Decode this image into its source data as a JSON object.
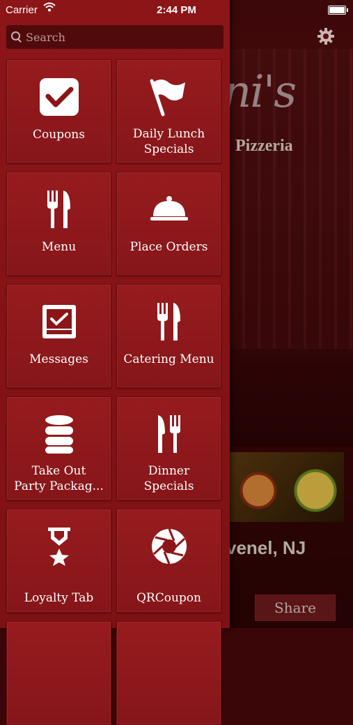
{
  "status_bar": {
    "carrier": "Carrier",
    "time": "2:44 PM",
    "wifi_icon": "wifi-icon",
    "battery_icon": "battery-icon"
  },
  "search": {
    "placeholder": "Search"
  },
  "settings": {
    "icon": "gear-icon"
  },
  "menu": {
    "items": [
      {
        "label": "Coupons",
        "icon": "checkbox-icon"
      },
      {
        "label": "Daily Lunch\nSpecials",
        "icon": "flag-icon"
      },
      {
        "label": "Menu",
        "icon": "fork-knife-icon"
      },
      {
        "label": "Place Orders",
        "icon": "cloche-icon"
      },
      {
        "label": "Messages",
        "icon": "inbox-check-icon"
      },
      {
        "label": "Catering Menu",
        "icon": "fork-knife-icon"
      },
      {
        "label": "Take Out\nParty Packag...",
        "icon": "database-icon"
      },
      {
        "label": "Dinner\nSpecials",
        "icon": "knife-fork-icon"
      },
      {
        "label": "Loyalty Tab",
        "icon": "award-star-icon"
      },
      {
        "label": "QRCoupon",
        "icon": "aperture-icon"
      }
    ]
  },
  "background": {
    "logo_script": "ni's",
    "logo_subtitle": "Pizzeria",
    "location": "venel, NJ",
    "share_label": "Share"
  },
  "colors": {
    "drawer": "#8c1518",
    "tile": "#961b1e",
    "search_bg": "#500a0c"
  }
}
